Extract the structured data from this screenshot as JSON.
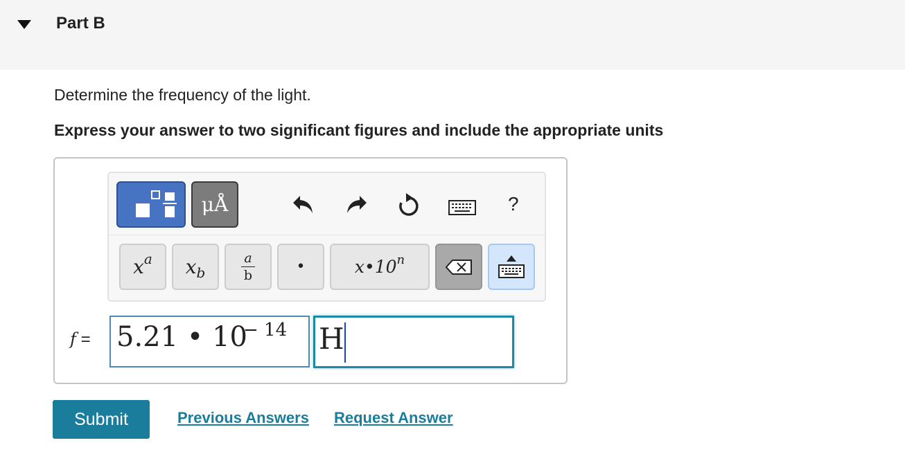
{
  "part": {
    "title": "Part B"
  },
  "question": {
    "text": "Determine the frequency of the light.",
    "instruction": "Express your answer to two significant figures and include the appropriate units"
  },
  "toolbar": {
    "units_label": "μÅ",
    "help_label": "?",
    "keys": {
      "superscript_base": "x",
      "superscript_exp": "a",
      "subscript_base": "x",
      "subscript_sub": "b",
      "fraction_num": "a",
      "fraction_den": "b",
      "dot": "•",
      "sci_notation": "x•10",
      "sci_exp": "n"
    },
    "colors": {
      "templates": "#4674c3",
      "units": "#7c7c7c",
      "backspace": "#a9a9a9",
      "keyboard": "#d4e6fb"
    }
  },
  "answer": {
    "variable": "f",
    "equals": "=",
    "value": "5.21 • 10",
    "exponent": "− 14",
    "units": "H"
  },
  "actions": {
    "submit_label": "Submit",
    "previous_answers_label": "Previous Answers",
    "request_answer_label": "Request Answer",
    "accent": "#1a7d9c"
  }
}
